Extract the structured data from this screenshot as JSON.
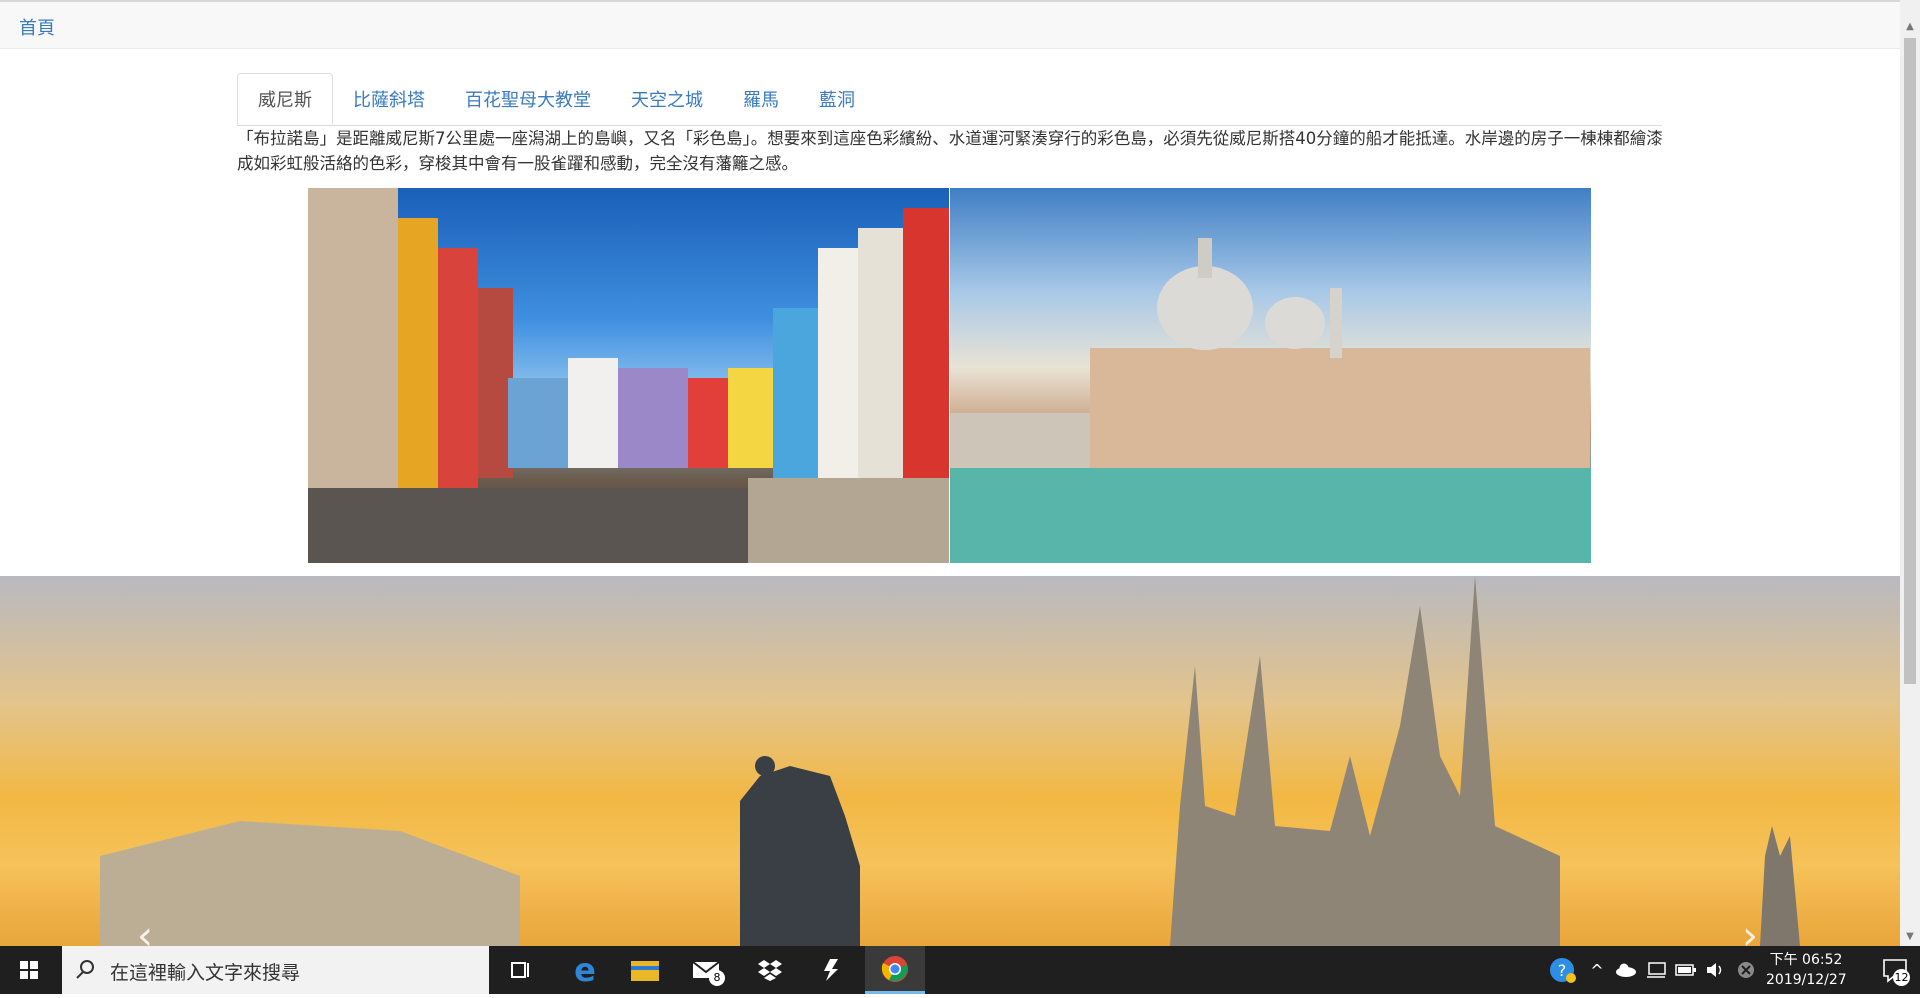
{
  "nav": {
    "home_label": "首頁"
  },
  "tabs": [
    {
      "label": "威尼斯",
      "active": true
    },
    {
      "label": "比薩斜塔",
      "active": false
    },
    {
      "label": "百花聖母大教堂",
      "active": false
    },
    {
      "label": "天空之城",
      "active": false
    },
    {
      "label": "羅馬",
      "active": false
    },
    {
      "label": "藍洞",
      "active": false
    }
  ],
  "content": {
    "description": "「布拉諾島」是距離威尼斯7公里處一座潟湖上的島嶼，又名「彩色島」。想要來到這座色彩繽紛、水道運河緊湊穿行的彩色島，必須先從威尼斯搭40分鐘的船才能抵達。水岸邊的房子一棟棟都繪漆成如彩虹般活絡的色彩，穿梭其中會有一股雀躍和感動，完全沒有藩籬之感。"
  },
  "carousel": {
    "prev_label": "‹",
    "next_label": "›"
  },
  "taskbar": {
    "search_placeholder": "在這裡輸入文字來搜尋",
    "mail_badge": "8",
    "clock_time": "下午 06:52",
    "clock_date": "2019/12/27",
    "notification_count": "12"
  }
}
